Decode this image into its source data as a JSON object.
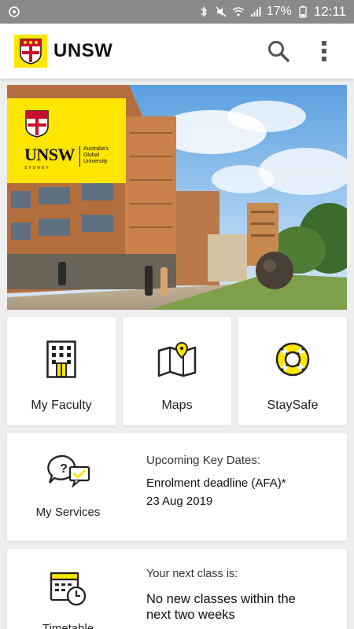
{
  "status_bar": {
    "battery": "17%",
    "time": "12:11"
  },
  "app_bar": {
    "title": "UNSW",
    "logo_icon": "unsw-crest-icon",
    "search_icon": "search-icon",
    "menu_icon": "more-vert-icon"
  },
  "hero": {
    "badge_wordmark": "UNSW",
    "badge_sydney": "SYDNEY",
    "badge_tagline": "Australia's Global University"
  },
  "tiles": [
    {
      "label": "My Faculty",
      "icon": "building-icon"
    },
    {
      "label": "Maps",
      "icon": "map-icon"
    },
    {
      "label": "StaySafe",
      "icon": "lifebuoy-icon"
    }
  ],
  "services": {
    "label": "My Services",
    "icon": "chat-bubbles-icon",
    "heading": "Upcoming Key Dates:",
    "event": "Enrolment deadline (AFA)*",
    "date": "23 Aug 2019"
  },
  "timetable": {
    "label": "Timetable",
    "icon": "calendar-clock-icon",
    "heading": "Your next class is:",
    "message": "No new classes within the next two weeks"
  },
  "colors": {
    "brand_yellow": "#ffe600",
    "status_bar": "#8a8a8a",
    "background": "#eeeeee"
  }
}
